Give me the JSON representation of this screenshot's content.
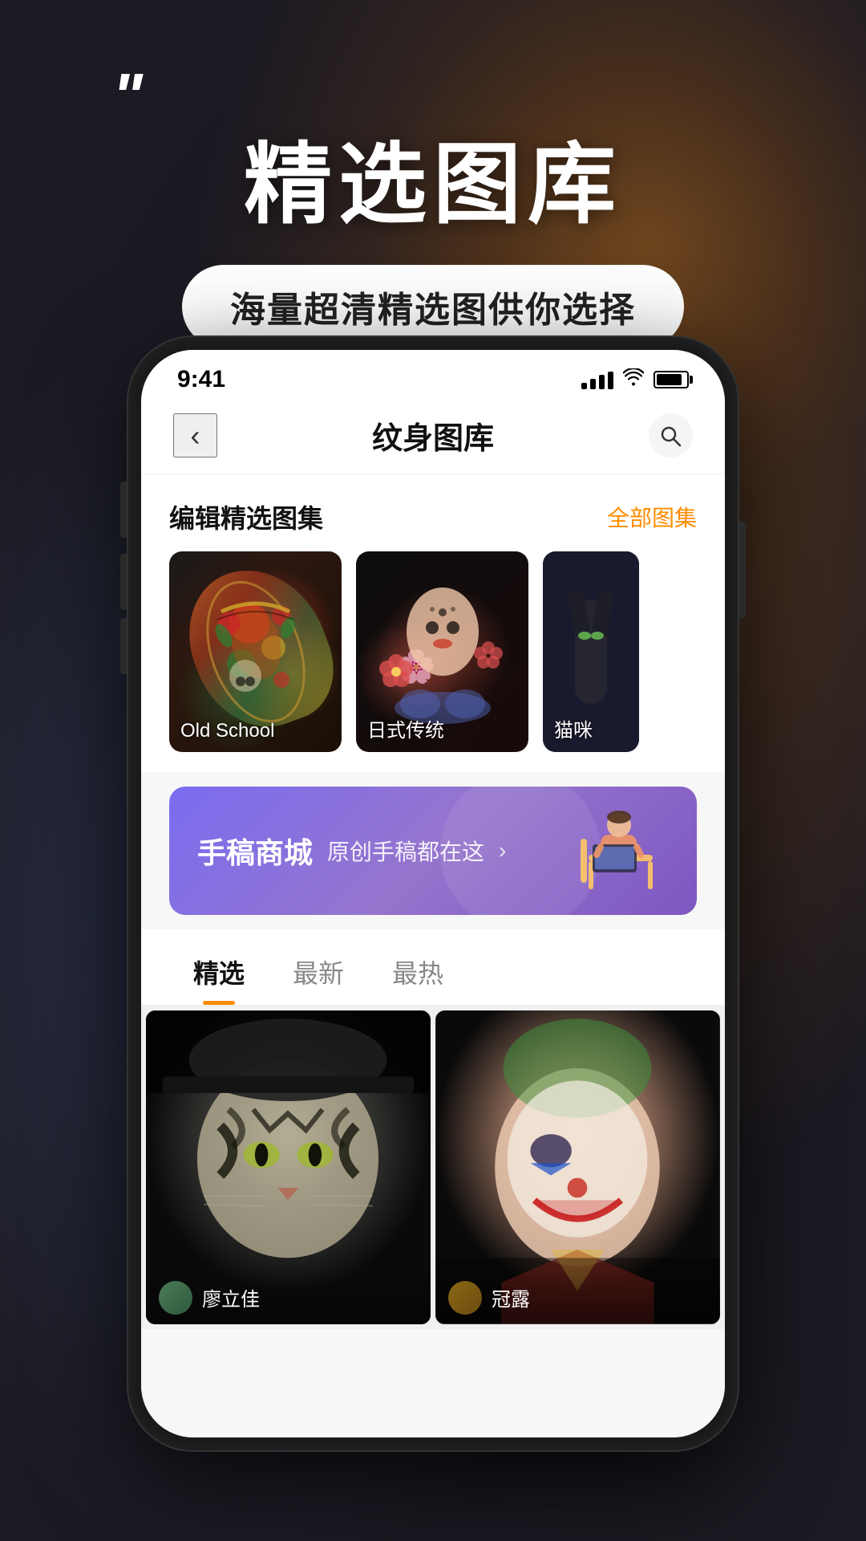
{
  "background": {
    "overlay_colors": [
      "#1c1a22",
      "#2a1a08"
    ]
  },
  "promo": {
    "quote_mark": "\"",
    "title": "精选图库",
    "subtitle": "海量超清精选图供你选择"
  },
  "statusBar": {
    "time": "9:41",
    "signal": "signal",
    "wifi": "wifi",
    "battery": "battery"
  },
  "navbar": {
    "back_label": "‹",
    "title": "纹身图库",
    "search_label": "search"
  },
  "editorSection": {
    "title": "编辑精选图集",
    "link": "全部图集",
    "cards": [
      {
        "id": "old-school",
        "label": "Old School"
      },
      {
        "id": "japanese",
        "label": "日式传统"
      },
      {
        "id": "cat",
        "label": "猫咪"
      }
    ]
  },
  "promoBanner": {
    "main_text": "手稿商城",
    "sub_text": "原创手稿都在这",
    "arrow": "›"
  },
  "tabs": [
    {
      "id": "featured",
      "label": "精选",
      "active": true
    },
    {
      "id": "newest",
      "label": "最新",
      "active": false
    },
    {
      "id": "hottest",
      "label": "最热",
      "active": false
    }
  ],
  "photoGrid": [
    {
      "id": "photo-tiger",
      "author": "廖立佳",
      "avatar_color": "#4a7c59"
    },
    {
      "id": "photo-joker",
      "author": "冠露",
      "avatar_color": "#8b6914"
    }
  ]
}
